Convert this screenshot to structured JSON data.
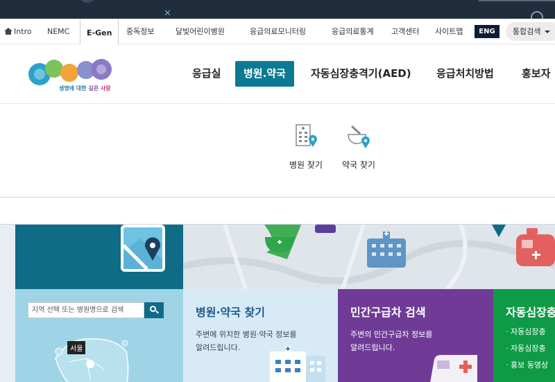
{
  "utility_nav": {
    "intro": "Intro",
    "nemc": "NEMC",
    "egen": "E-Gen",
    "items": [
      "중독정보",
      "달빛어린이병원",
      "응급의료모니터링",
      "응급의료통계",
      "고객센터",
      "사이트맵"
    ],
    "eng": "ENG",
    "integrated_search": "통합검색"
  },
  "logo": {
    "slogan_a": "생명에 대한 ",
    "slogan_b": "깊은 ",
    "slogan_c": "사랑"
  },
  "gnb": {
    "items": [
      "응급실",
      "병원.약국",
      "자동심장충격기(AED)",
      "응급처치방법",
      "홍보자"
    ],
    "active_index": 1
  },
  "submenu": {
    "hospital": "병원 찾기",
    "pharmacy": "약국 찾기"
  },
  "map_search": {
    "placeholder": "지역 선택 또는 병원명으로 검색",
    "seoul": "서울"
  },
  "cards": {
    "hospital": {
      "title": "병원·약국 찾기",
      "desc_1": "주변에 위치한 병원·약국 정보를",
      "desc_2": "알려드립니다."
    },
    "ambulance": {
      "title": "민간구급차 검색",
      "desc_1": "주변의 민간구급차 정보를",
      "desc_2": "알려드립니다."
    },
    "aed": {
      "title": "자동심장충",
      "items": [
        "자동심장충",
        "자동심장충",
        "홍보 동영상"
      ]
    }
  },
  "colors": {
    "brand_teal": "#0c7a92",
    "aed_green": "#0e9a46",
    "ambulance_purple": "#6f3b97"
  }
}
